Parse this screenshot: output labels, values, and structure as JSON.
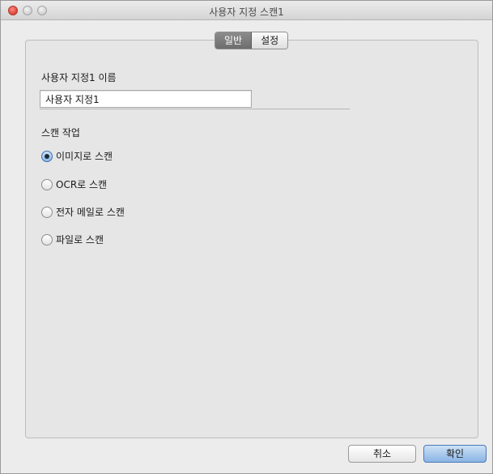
{
  "window": {
    "title": "사용자 지정 스캔1"
  },
  "tabs": [
    {
      "label": "일반",
      "active": true
    },
    {
      "label": "설정",
      "active": false
    }
  ],
  "general": {
    "name_label": "사용자 지정1 이름",
    "name_value": "사용자 지정1",
    "scan_action_label": "스캔 작업",
    "options": [
      {
        "label": "이미지로 스캔",
        "selected": true
      },
      {
        "label": "OCR로 스캔",
        "selected": false
      },
      {
        "label": "전자 메일로 스캔",
        "selected": false
      },
      {
        "label": "파일로 스캔",
        "selected": false
      }
    ]
  },
  "buttons": {
    "cancel": "취소",
    "ok": "확인"
  },
  "colors": {
    "window_bg": "#ececec",
    "panel_bg": "#e6e6e6",
    "accent": "#8ab4e4",
    "close_button": "#d8463a"
  }
}
